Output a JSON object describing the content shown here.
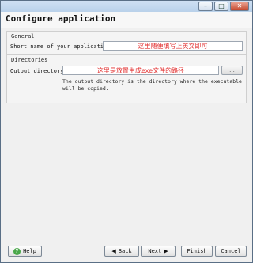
{
  "window": {
    "minimize_glyph": "–",
    "restore_glyph": "□",
    "close_glyph": "✕"
  },
  "header": {
    "title": "Configure application"
  },
  "general": {
    "group_title": "General",
    "short_name_label": "Short name of your application:",
    "short_name_value": "这里随便填写上英文即可"
  },
  "directories": {
    "group_title": "Directories",
    "output_label": "Output directory:",
    "output_value": "这里是放置生成exe文件的路径",
    "browse_label": "...",
    "description": "The output directory is the directory where the executable\nwill be copied."
  },
  "footer": {
    "help_label": "Help",
    "help_icon": "?",
    "back_label": "Back",
    "back_arrow": "◀",
    "next_label": "Next",
    "next_arrow": "▶",
    "finish_label": "Finish",
    "cancel_label": "Cancel"
  },
  "colors": {
    "annotation_text": "#e23030",
    "window_bg": "#f0f0f0"
  }
}
